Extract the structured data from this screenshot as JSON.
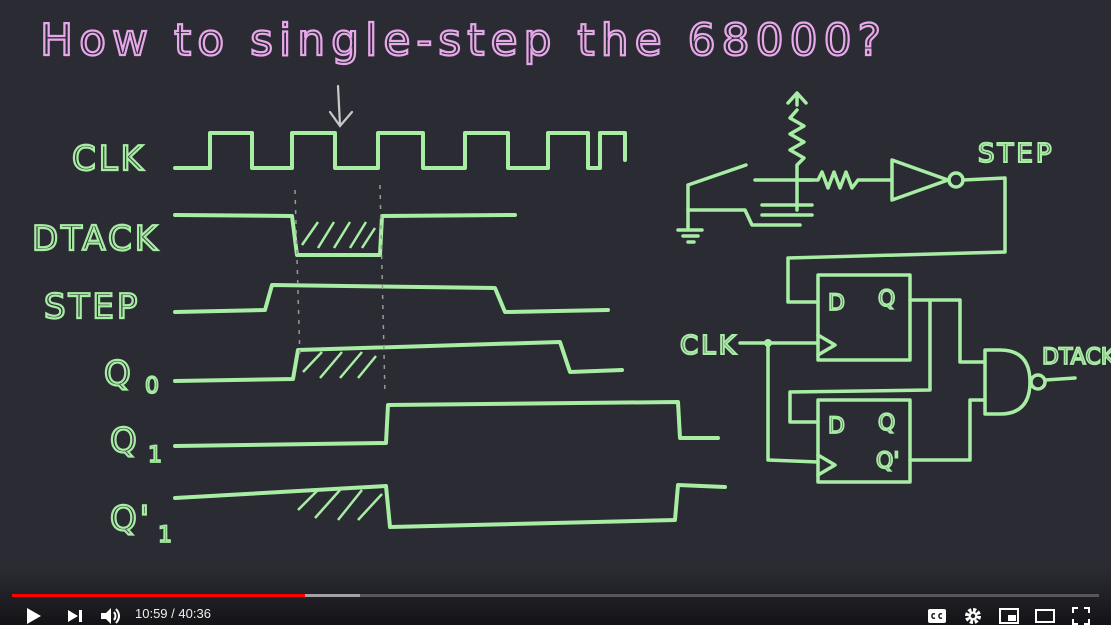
{
  "video": {
    "title_text": "How to single-step the 68000?",
    "signals": [
      "CLK",
      "DTACK",
      "STEP",
      "Q",
      "Q",
      "Q'"
    ],
    "subscripts": [
      "0",
      "1",
      "1"
    ],
    "circuit": {
      "step_label": "STEP",
      "clk_label": "CLK",
      "dtack_label": "DTACK",
      "ff_d": "D",
      "ff_q": "Q",
      "ff_qbar": "Q'"
    }
  },
  "player": {
    "current_time": "10:59",
    "separator": " / ",
    "duration": "40:36",
    "played_fraction": 0.27,
    "buffered_fraction": 0.32,
    "progress_color": "#ff0000"
  }
}
